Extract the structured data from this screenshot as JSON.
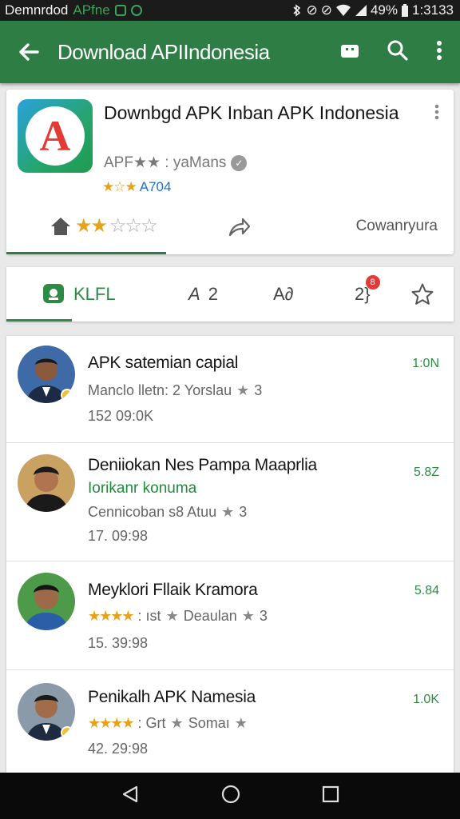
{
  "status_bar": {
    "app_text": "Demnrdod",
    "app_name": "APfne",
    "battery": "49%",
    "time": "1:3133"
  },
  "app_bar": {
    "title": "Download APIIndonesia",
    "icons": [
      "back-arrow-icon",
      "store-icon",
      "search-icon",
      "more-vert-icon"
    ]
  },
  "app_card": {
    "name": "Downbgd APK Inban APK Indonesia",
    "developer": "APF★★ : yaMans",
    "rating_label": "A704",
    "category": "Cowanryura"
  },
  "tabs": [
    {
      "label": "KLFL",
      "active": true
    },
    {
      "label": "2"
    },
    {
      "label": "A∂"
    },
    {
      "label": "2}",
      "badge": "8"
    },
    {
      "label": ""
    }
  ],
  "reviews": [
    {
      "title": "APK satemian capial",
      "subtitle": "",
      "meta_a": "Manclo lletn: 2 Yorslau",
      "meta_b": "3",
      "date": "152 09:0K",
      "count": "1:0N"
    },
    {
      "title": "Deniiokan Nes Pampa Maaprlia",
      "subtitle": "Iorikanr konuma",
      "meta_a": "Cennicoban s8 Atuu",
      "meta_b": "3",
      "date": "17. 09:98",
      "count": "5.8Z"
    },
    {
      "title": "Meyklori Fllaik Kramora",
      "subtitle": "",
      "meta_a": ": ıst",
      "meta_c": "Deaulan",
      "meta_b": "3",
      "date": "15. 39:98",
      "count": "5.84"
    },
    {
      "title": "Penikalh APK Namesia",
      "subtitle": "",
      "meta_a": ": Grt",
      "meta_c": "Somaı",
      "meta_b": "",
      "date": "42. 29:98",
      "count": "1.0K"
    }
  ],
  "colors": {
    "app_bar": "#2e7d45",
    "accent": "#2e8b45",
    "star": "#e8a21a"
  }
}
